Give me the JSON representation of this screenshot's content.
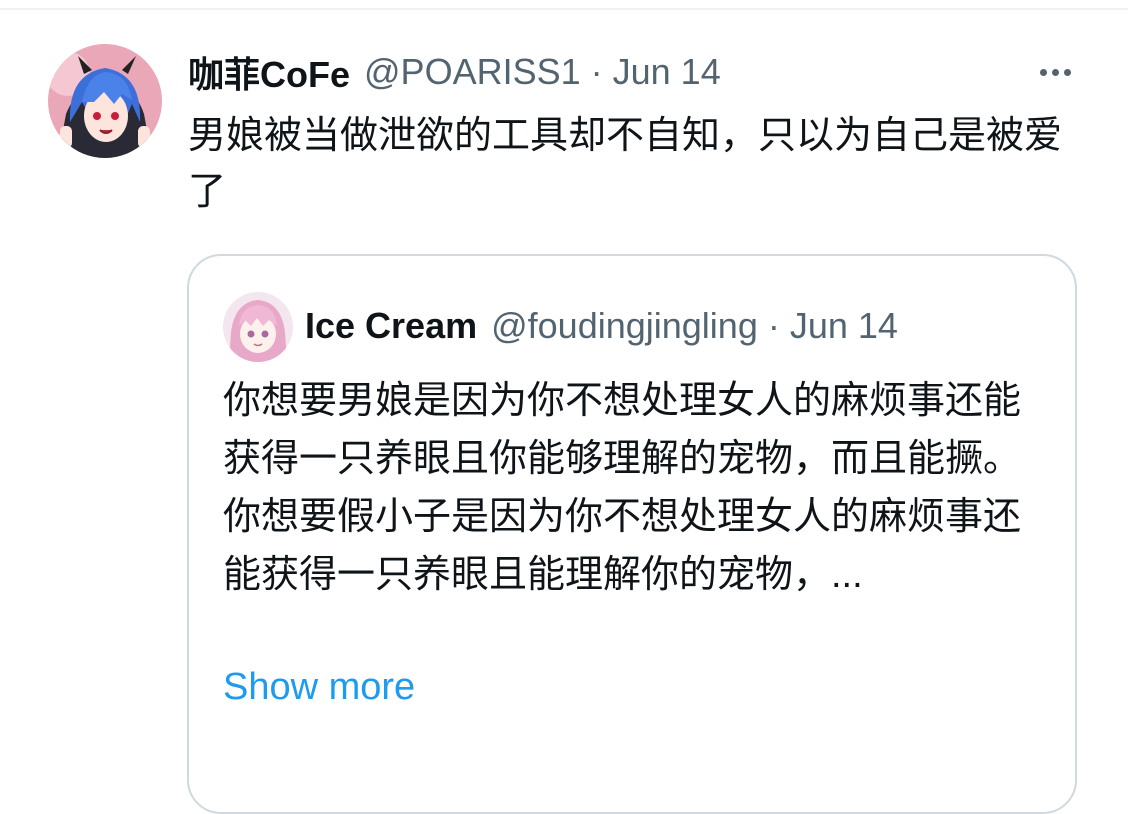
{
  "tweet": {
    "author": {
      "display_name": "咖菲CoFe",
      "handle": "@POARISS1",
      "separator": "·",
      "date": "Jun 14",
      "avatar_icon": "anime-avatar-blue-hair"
    },
    "more_icon": "more-horizontal-icon",
    "text": "男娘被当做泄欲的工具却不自知，只以为自己是被爱了"
  },
  "quote": {
    "author": {
      "display_name": "Ice Cream",
      "handle": "@foudingjingling",
      "separator": "·",
      "date": "Jun 14",
      "avatar_icon": "anime-avatar-pink-hair"
    },
    "text": "你想要男娘是因为你不想处理女人的麻烦事还能获得一只养眼且你能够理解的宠物，而且能撅。\n你想要假小子是因为你不想处理女人的麻烦事还能获得一只养眼且能理解你的宠物，...",
    "show_more_label": "Show more"
  },
  "colors": {
    "text_primary": "#0f1419",
    "text_secondary": "#536471",
    "link": "#1d9bf0",
    "border": "#cfd9de"
  }
}
